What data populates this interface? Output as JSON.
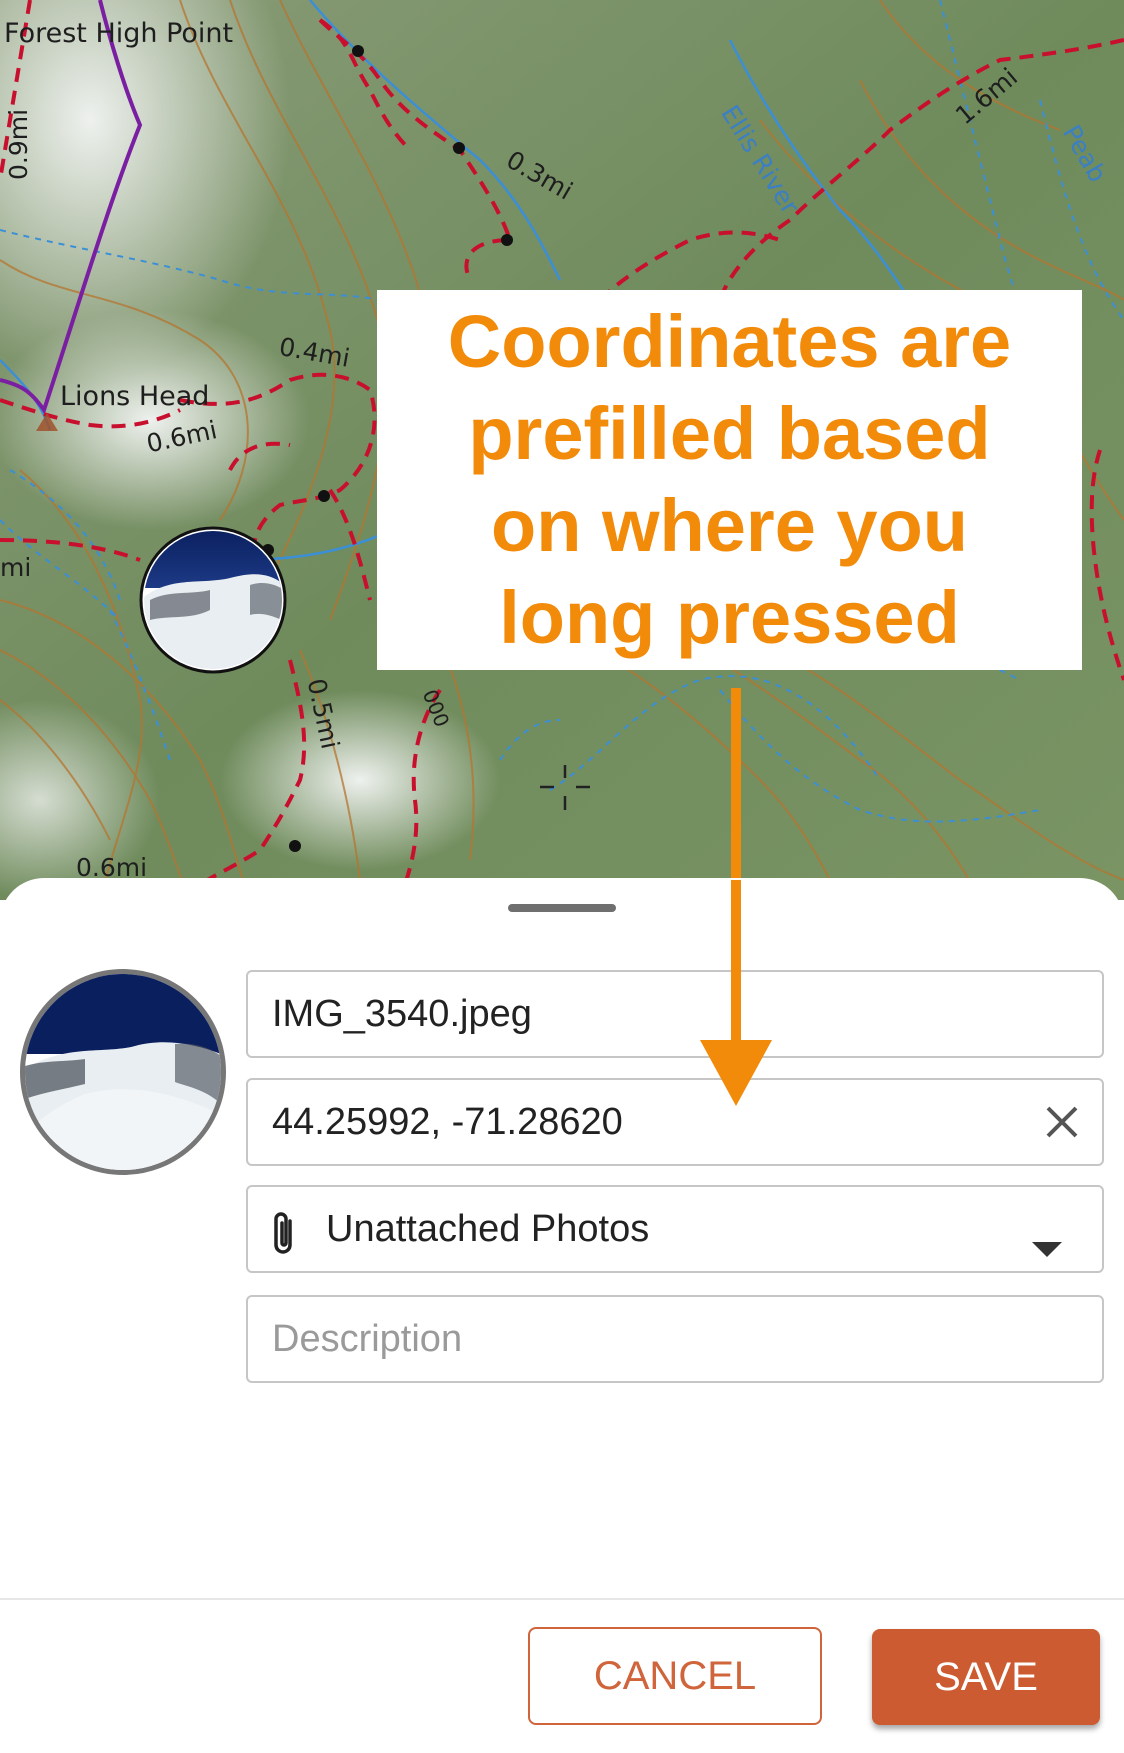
{
  "map": {
    "labels": {
      "forest_high_point": "Forest High Point",
      "lions_head": "Lions Head",
      "ellis_river": "Ellis River",
      "peab": "Peab",
      "elevation": "000"
    },
    "distances": {
      "d1": "0.9mi",
      "d2": "0.3mi",
      "d3": "1.6mi",
      "d4": "0.4mi",
      "d5": "0.6mi",
      "d6": "mi",
      "d7": "0.5mi",
      "d8": "0.6mi"
    },
    "colors": {
      "trail": "#c8102e",
      "route": "#7b1fa2",
      "water": "#3b8fd6",
      "contour": "#b5752f"
    }
  },
  "callout": {
    "lines": [
      "Coordinates are",
      "prefilled based",
      "on where you",
      "long pressed"
    ],
    "color": "#f28a0a"
  },
  "sheet": {
    "filename": "IMG_3540.jpeg",
    "coordinates": "44.25992, -71.28620",
    "folder": "Unattached Photos",
    "description_placeholder": "Description",
    "cancel_label": "CANCEL",
    "save_label": "SAVE",
    "accent": "#cd5b31"
  },
  "icons": {
    "clear": "close-icon",
    "attach": "paperclip-icon",
    "dropdown": "dropdown-arrow-icon"
  }
}
